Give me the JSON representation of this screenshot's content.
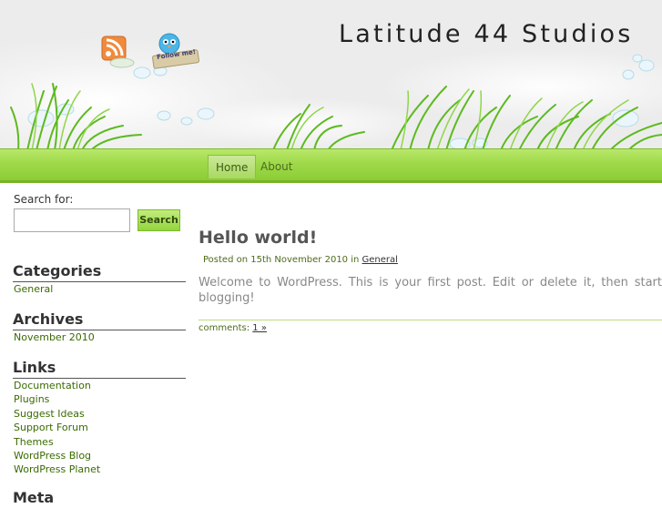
{
  "header": {
    "site_title": "Latitude 44 Studios",
    "rss_icon": "rss-feed-icon",
    "twitter_icon": "twitter-follow-bird-icon",
    "twitter_badge_text": "Follow me!"
  },
  "nav": {
    "items": [
      {
        "label": "Home",
        "active": true
      },
      {
        "label": "About",
        "active": false
      }
    ]
  },
  "sidebar": {
    "search": {
      "label": "Search for:",
      "value": "",
      "button": "Search"
    },
    "categories": {
      "title": "Categories",
      "items": [
        "General"
      ]
    },
    "archives": {
      "title": "Archives",
      "items": [
        "November 2010"
      ]
    },
    "links": {
      "title": "Links",
      "items": [
        "Documentation",
        "Plugins",
        "Suggest Ideas",
        "Support Forum",
        "Themes",
        "WordPress Blog",
        "WordPress Planet"
      ]
    },
    "meta": {
      "title": "Meta"
    }
  },
  "post": {
    "title": "Hello world!",
    "meta_prefix": "Posted on 15th November 2010 in",
    "category": "General",
    "body": "Welcome to WordPress. This is your first post. Edit or delete it, then start blogging!",
    "comments_label": "comments:",
    "comments_link": "1 »"
  },
  "colors": {
    "accent_green": "#9fd94a",
    "link_green": "#3a6b00",
    "title_text": "#222222"
  }
}
